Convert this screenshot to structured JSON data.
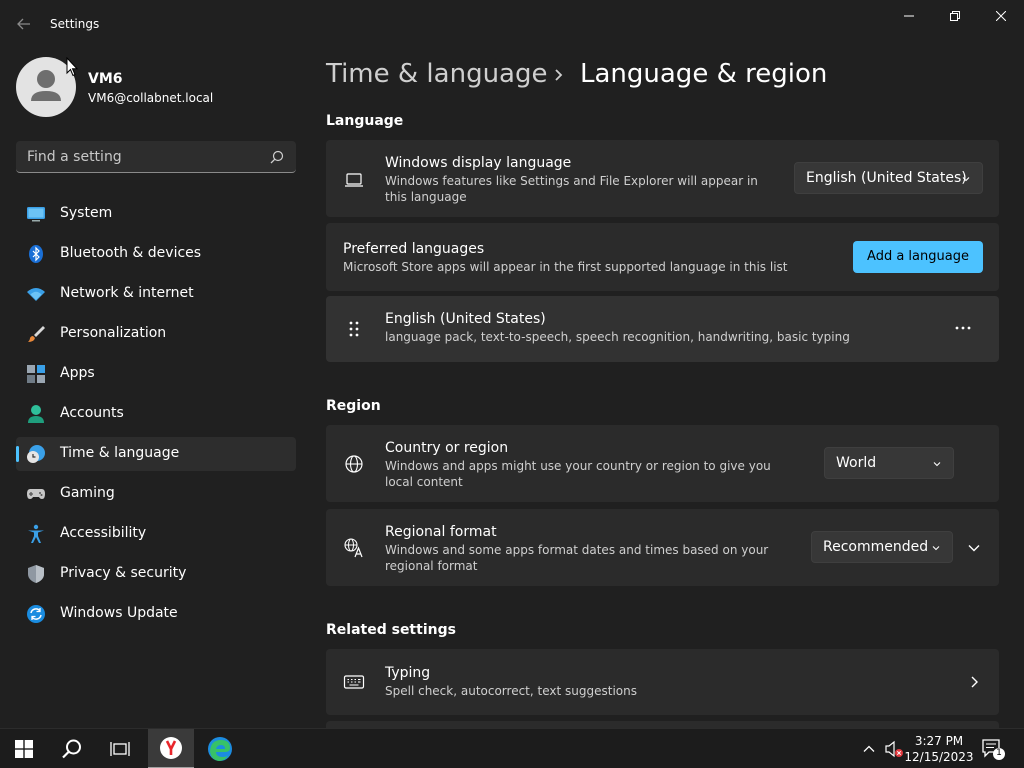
{
  "window": {
    "title": "Settings"
  },
  "profile": {
    "name": "VM6",
    "email": "VM6@collabnet.local"
  },
  "search": {
    "placeholder": "Find a setting"
  },
  "nav": {
    "items": [
      {
        "label": "System",
        "icon": "monitor-icon"
      },
      {
        "label": "Bluetooth & devices",
        "icon": "bluetooth-icon"
      },
      {
        "label": "Network & internet",
        "icon": "wifi-icon"
      },
      {
        "label": "Personalization",
        "icon": "brush-icon"
      },
      {
        "label": "Apps",
        "icon": "apps-icon"
      },
      {
        "label": "Accounts",
        "icon": "person-icon"
      },
      {
        "label": "Time & language",
        "icon": "globe-clock-icon",
        "selected": true
      },
      {
        "label": "Gaming",
        "icon": "gamepad-icon"
      },
      {
        "label": "Accessibility",
        "icon": "accessibility-icon"
      },
      {
        "label": "Privacy & security",
        "icon": "shield-icon"
      },
      {
        "label": "Windows Update",
        "icon": "update-icon"
      }
    ]
  },
  "breadcrumb": {
    "parent": "Time & language",
    "current": "Language & region"
  },
  "language": {
    "heading": "Language",
    "display": {
      "title": "Windows display language",
      "desc": "Windows features like Settings and File Explorer will appear in this language",
      "value": "English (United States)"
    },
    "preferred": {
      "title": "Preferred languages",
      "desc": "Microsoft Store apps will appear in the first supported language in this list",
      "button": "Add a language"
    },
    "installed": {
      "title": "English (United States)",
      "desc": "language pack, text-to-speech, speech recognition, handwriting, basic typing"
    }
  },
  "region": {
    "heading": "Region",
    "country": {
      "title": "Country or region",
      "desc": "Windows and apps might use your country or region to give you local content",
      "value": "World"
    },
    "format": {
      "title": "Regional format",
      "desc": "Windows and some apps format dates and times based on your regional format",
      "value": "Recommended"
    }
  },
  "related": {
    "heading": "Related settings",
    "typing": {
      "title": "Typing",
      "desc": "Spell check, autocorrect, text suggestions"
    }
  },
  "taskbar": {
    "time": "3:27 PM",
    "date": "12/15/2023",
    "notification_count": "1"
  },
  "colors": {
    "accent": "#4cc2ff",
    "background": "#202020",
    "card": "#2b2b2b"
  }
}
